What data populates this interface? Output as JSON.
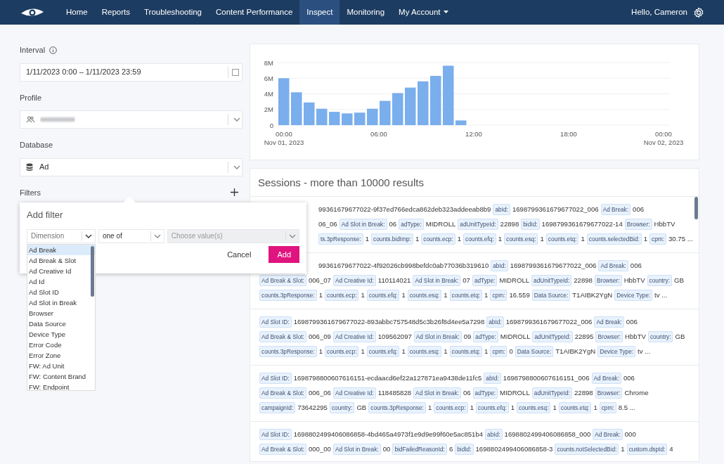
{
  "navbar": {
    "items": [
      {
        "label": "Home",
        "selected": false,
        "kind": "link"
      },
      {
        "label": "Reports",
        "selected": false,
        "kind": "link"
      },
      {
        "label": "Troubleshooting",
        "selected": false,
        "kind": "link"
      },
      {
        "label": "Content Performance",
        "selected": false,
        "kind": "link"
      },
      {
        "label": "Inspect",
        "selected": true,
        "kind": "link"
      },
      {
        "label": "Monitoring",
        "selected": false,
        "kind": "link"
      },
      {
        "label": "My Account",
        "selected": false,
        "kind": "dropdown"
      }
    ],
    "greeting": "Hello, Cameron"
  },
  "sidebar": {
    "interval": {
      "label": "Interval",
      "value": "1/11/2023 0:00 – 1/11/2023 23:59"
    },
    "profile": {
      "label": "Profile"
    },
    "database": {
      "label": "Database",
      "value": "Ad"
    },
    "filters": {
      "label": "Filters"
    }
  },
  "add_filter": {
    "title": "Add filter",
    "dimension": {
      "placeholder": "Dimension"
    },
    "operator": {
      "value": "one of"
    },
    "values": {
      "placeholder": "Choose value(s)",
      "disabled": true
    },
    "cancel": "Cancel",
    "add": "Add",
    "options": [
      {
        "label": "Ad Break",
        "selected": true
      },
      {
        "label": "Ad Break & Slot",
        "selected": false
      },
      {
        "label": "Ad Creative Id",
        "selected": false
      },
      {
        "label": "Ad Id",
        "selected": false
      },
      {
        "label": "Ad Slot ID",
        "selected": false
      },
      {
        "label": "Ad Slot in Break",
        "selected": false
      },
      {
        "label": "Browser",
        "selected": false
      },
      {
        "label": "Data Source",
        "selected": false
      },
      {
        "label": "Device Type",
        "selected": false
      },
      {
        "label": "Error Code",
        "selected": false
      },
      {
        "label": "Error Zone",
        "selected": false
      },
      {
        "label": "FW: Ad Unit",
        "selected": false
      },
      {
        "label": "FW: Content Brand",
        "selected": false
      },
      {
        "label": "FW: Endpoint",
        "selected": false
      }
    ]
  },
  "chart": {
    "start_date": "Nov 01, 2023",
    "end_date": "Nov 02, 2023",
    "chart_data": {
      "type": "bar",
      "x": [
        0,
        0.8,
        1.6,
        2.4,
        3.2,
        4,
        4.8,
        5.6,
        6.4,
        7.2,
        8,
        8.8,
        9.6,
        10.4,
        11.2
      ],
      "series": [
        {
          "color": "#7aaeec",
          "values": [
            6000000,
            4200000,
            2900000,
            2100000,
            1700000,
            1500000,
            1600000,
            2100000,
            3100000,
            4100000,
            4800000,
            5600000,
            6300000,
            7600000,
            600000
          ]
        }
      ],
      "xlim": [
        -0.4,
        24.4
      ],
      "ylim": [
        0,
        8000000
      ],
      "grid": true,
      "xticks": [
        {
          "value": 0,
          "label": "00:00"
        },
        {
          "value": 6,
          "label": "06:00"
        },
        {
          "value": 12,
          "label": "12:00"
        },
        {
          "value": 18,
          "label": "18:00"
        },
        {
          "value": 24,
          "label": "00:00"
        }
      ],
      "yticks": [
        {
          "value": 0,
          "label": "0"
        },
        {
          "value": 2000000,
          "label": "2M"
        },
        {
          "value": 4000000,
          "label": "4M"
        },
        {
          "value": 6000000,
          "label": "6M"
        },
        {
          "value": 8000000,
          "label": "8M"
        }
      ]
    }
  },
  "sessions": {
    "title": "Sessions - more than 10000 results",
    "rows": [
      {
        "lines": [
          {
            "kind": "cut",
            "items": [
              {
                "value": "99361679677022-9f37ed766edca862deb323addeeab8b9"
              },
              {
                "key": "abId:",
                "value": "1698799361679677022_006"
              },
              {
                "key": "Ad Break:",
                "value": "006"
              }
            ]
          },
          {
            "kind": "cut",
            "items": [
              {
                "value": "06_06"
              },
              {
                "key": "Ad Slot in Break:",
                "value": "06"
              },
              {
                "key": "adType:",
                "value": "MIDROLL"
              },
              {
                "key": "adUnitTypeId:",
                "value": "22898"
              },
              {
                "key": "bidId:",
                "value": "1698799361679677022-14"
              },
              {
                "key": "Browser:",
                "value": "HbbTV"
              }
            ]
          },
          {
            "kind": "cut",
            "items": [
              {
                "key": "ts.3pResponse:",
                "value": "1"
              },
              {
                "key": "counts.bidImp:",
                "value": "1"
              },
              {
                "key": "counts.ecp:",
                "value": "1"
              },
              {
                "key": "counts.efq:",
                "value": "1"
              },
              {
                "key": "counts.esq:",
                "value": "1"
              },
              {
                "key": "counts.etq:",
                "value": "1"
              },
              {
                "key": "counts.selectedBid:",
                "value": "1"
              },
              {
                "key": "cpm:",
                "value": "30.75 ..."
              }
            ]
          }
        ]
      },
      {
        "lines": [
          {
            "kind": "cut",
            "items": [
              {
                "value": "99361679677022-4f92026cb998befdc0ab77036b319610"
              },
              {
                "key": "abId:",
                "value": "1698799361679677022_006"
              },
              {
                "key": "Ad Break:",
                "value": "006"
              }
            ]
          },
          {
            "kind": "full",
            "items": [
              {
                "key": "Ad Break & Slot:",
                "value": "006_07"
              },
              {
                "key": "Ad Creative Id:",
                "value": "110114021"
              },
              {
                "key": "Ad Slot in Break:",
                "value": "07"
              },
              {
                "key": "adType:",
                "value": "MIDROLL"
              },
              {
                "key": "adUnitTypeId:",
                "value": "22898"
              },
              {
                "key": "Browser:",
                "value": "HbbTV"
              },
              {
                "key": "country:",
                "value": "GB"
              }
            ]
          },
          {
            "kind": "full",
            "items": [
              {
                "key": "counts.3pResponse:",
                "value": "1"
              },
              {
                "key": "counts.ecp:",
                "value": "1"
              },
              {
                "key": "counts.efq:",
                "value": "1"
              },
              {
                "key": "counts.esq:",
                "value": "1"
              },
              {
                "key": "counts.etq:",
                "value": "1"
              },
              {
                "key": "cpm:",
                "value": "16.559"
              },
              {
                "key": "Data Source:",
                "value": "T1AIBK2YgN"
              },
              {
                "key": "Device Type:",
                "value": "tv ..."
              }
            ]
          }
        ]
      },
      {
        "lines": [
          {
            "kind": "full",
            "items": [
              {
                "key": "Ad Slot ID:",
                "value": "1698799361679677022-893abbc757548d5c3b26f8d4ee5a7298"
              },
              {
                "key": "abId:",
                "value": "1698799361679677022_006"
              },
              {
                "key": "Ad Break:",
                "value": "006"
              }
            ]
          },
          {
            "kind": "full",
            "items": [
              {
                "key": "Ad Break & Slot:",
                "value": "006_09"
              },
              {
                "key": "Ad Creative Id:",
                "value": "109562097"
              },
              {
                "key": "Ad Slot in Break:",
                "value": "09"
              },
              {
                "key": "adType:",
                "value": "MIDROLL"
              },
              {
                "key": "adUnitTypeId:",
                "value": "22895"
              },
              {
                "key": "Browser:",
                "value": "HbbTV"
              },
              {
                "key": "country:",
                "value": "GB"
              }
            ]
          },
          {
            "kind": "full",
            "items": [
              {
                "key": "counts.3pResponse:",
                "value": "1"
              },
              {
                "key": "counts.ecp:",
                "value": "1"
              },
              {
                "key": "counts.efq:",
                "value": "1"
              },
              {
                "key": "counts.esq:",
                "value": "1"
              },
              {
                "key": "counts.etq:",
                "value": "1"
              },
              {
                "key": "cpm:",
                "value": "0"
              },
              {
                "key": "Data Source:",
                "value": "T1AIBK2YgN"
              },
              {
                "key": "Device Type:",
                "value": "tv ..."
              }
            ]
          }
        ]
      },
      {
        "lines": [
          {
            "kind": "full",
            "items": [
              {
                "key": "Ad Slot ID:",
                "value": "1698798800607616151-ecdaacd6ef22a127871ea9438de11fc5"
              },
              {
                "key": "abId:",
                "value": "1698798800607616151_006"
              },
              {
                "key": "Ad Break:",
                "value": "006"
              }
            ]
          },
          {
            "kind": "full",
            "items": [
              {
                "key": "Ad Break & Slot:",
                "value": "006_06"
              },
              {
                "key": "Ad Creative Id:",
                "value": "118485828"
              },
              {
                "key": "Ad Slot in Break:",
                "value": "06"
              },
              {
                "key": "adType:",
                "value": "MIDROLL"
              },
              {
                "key": "adUnitTypeId:",
                "value": "22898"
              },
              {
                "key": "Browser:",
                "value": "Chrome"
              }
            ]
          },
          {
            "kind": "full",
            "items": [
              {
                "key": "campaignId:",
                "value": "73642295"
              },
              {
                "key": "country:",
                "value": "GB"
              },
              {
                "key": "counts.3pResponse:",
                "value": "1"
              },
              {
                "key": "counts.ecp:",
                "value": "1"
              },
              {
                "key": "counts.efq:",
                "value": "1"
              },
              {
                "key": "counts.esq:",
                "value": "1"
              },
              {
                "key": "counts.etq:",
                "value": "1"
              },
              {
                "key": "cpm:",
                "value": "8.5 ..."
              }
            ]
          }
        ]
      },
      {
        "lines": [
          {
            "kind": "full",
            "items": [
              {
                "key": "Ad Slot ID:",
                "value": "1698802499406086858-4bd465a4973f1e9d9e99f60e5ac851b4"
              },
              {
                "key": "abId:",
                "value": "1698802499406086858_000"
              },
              {
                "key": "Ad Break:",
                "value": "000"
              }
            ]
          },
          {
            "kind": "full",
            "items": [
              {
                "key": "Ad Break & Slot:",
                "value": "000_00"
              },
              {
                "key": "Ad Slot in Break:",
                "value": "00"
              },
              {
                "key": "bidFailedReasonId:",
                "value": "6"
              },
              {
                "key": "bidId:",
                "value": "1698802499406086858-3"
              },
              {
                "key": "counts.notSelectedBid:",
                "value": "1"
              },
              {
                "key": "custom.dspId:",
                "value": "4"
              }
            ]
          }
        ]
      }
    ]
  }
}
